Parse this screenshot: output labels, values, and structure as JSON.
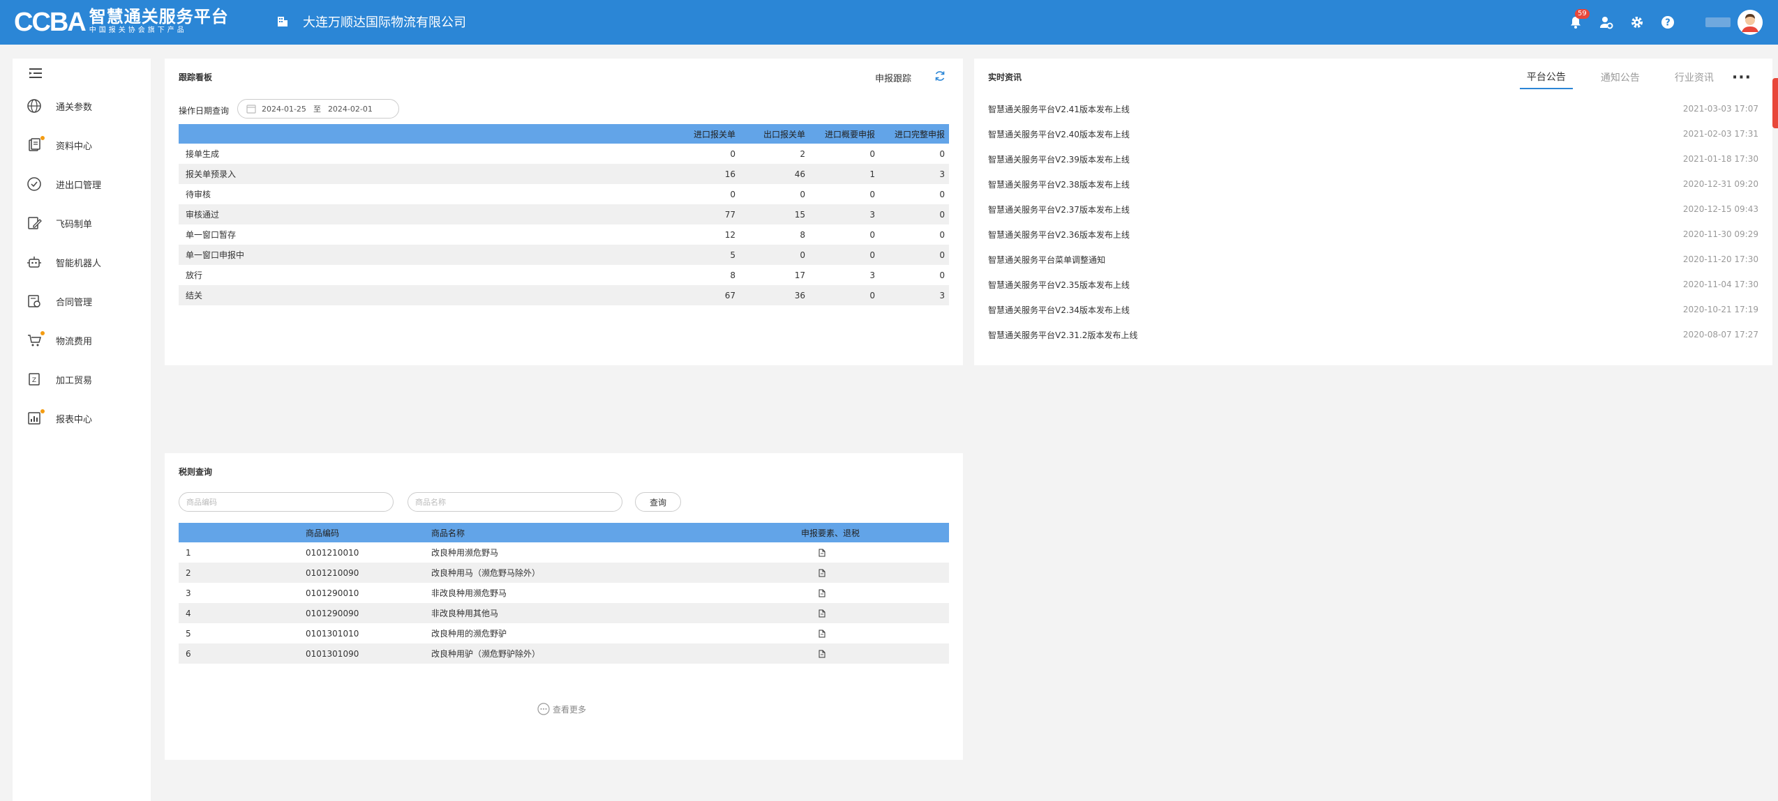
{
  "header": {
    "logo_mark": "CCBA",
    "logo_cn": "智慧通关服务平台",
    "logo_sub": "中国报关协会旗下产品",
    "company": "大连万顺达国际物流有限公司",
    "notification_count": "59"
  },
  "sidebar": {
    "items": [
      {
        "label": "通关参数",
        "icon": "globe-icon",
        "dot": false
      },
      {
        "label": "资料中心",
        "icon": "documents-icon",
        "dot": true
      },
      {
        "label": "进出口管理",
        "icon": "clock-check-icon",
        "dot": false
      },
      {
        "label": "飞码制单",
        "icon": "edit-doc-icon",
        "dot": false
      },
      {
        "label": "智能机器人",
        "icon": "robot-icon",
        "dot": false
      },
      {
        "label": "合同管理",
        "icon": "contract-icon",
        "dot": false
      },
      {
        "label": "物流费用",
        "icon": "cart-icon",
        "dot": true
      },
      {
        "label": "加工贸易",
        "icon": "trade-icon",
        "dot": false
      },
      {
        "label": "报表中心",
        "icon": "chart-icon",
        "dot": true
      }
    ]
  },
  "tracking": {
    "title": "跟踪看板",
    "link": "申报跟踪",
    "date_label": "操作日期查询",
    "date_from": "2024-01-25",
    "date_sep": "至",
    "date_to": "2024-02-01",
    "columns": [
      "",
      "进口报关单",
      "出口报关单",
      "进口概要申报",
      "进口完整申报"
    ],
    "rows": [
      [
        "接单生成",
        "0",
        "2",
        "0",
        "0"
      ],
      [
        "报关单预录入",
        "16",
        "46",
        "1",
        "3"
      ],
      [
        "待审核",
        "0",
        "0",
        "0",
        "0"
      ],
      [
        "审核通过",
        "77",
        "15",
        "3",
        "0"
      ],
      [
        "单一窗口暂存",
        "12",
        "8",
        "0",
        "0"
      ],
      [
        "单一窗口申报中",
        "5",
        "0",
        "0",
        "0"
      ],
      [
        "放行",
        "8",
        "17",
        "3",
        "0"
      ],
      [
        "结关",
        "67",
        "36",
        "0",
        "3"
      ]
    ]
  },
  "news": {
    "title": "实时资讯",
    "tabs": [
      "平台公告",
      "通知公告",
      "行业资讯"
    ],
    "more": "···",
    "items": [
      {
        "title": "智慧通关服务平台V2.41版本发布上线",
        "date": "2021-03-03 17:07"
      },
      {
        "title": "智慧通关服务平台V2.40版本发布上线",
        "date": "2021-02-03 17:31"
      },
      {
        "title": "智慧通关服务平台V2.39版本发布上线",
        "date": "2021-01-18 17:30"
      },
      {
        "title": "智慧通关服务平台V2.38版本发布上线",
        "date": "2020-12-31 09:20"
      },
      {
        "title": "智慧通关服务平台V2.37版本发布上线",
        "date": "2020-12-15 09:43"
      },
      {
        "title": "智慧通关服务平台V2.36版本发布上线",
        "date": "2020-11-30 09:29"
      },
      {
        "title": "智慧通关服务平台菜单调整通知",
        "date": "2020-11-20 17:30"
      },
      {
        "title": "智慧通关服务平台V2.35版本发布上线",
        "date": "2020-11-04 17:30"
      },
      {
        "title": "智慧通关服务平台V2.34版本发布上线",
        "date": "2020-10-21 17:19"
      },
      {
        "title": "智慧通关服务平台V2.31.2版本发布上线",
        "date": "2020-08-07 17:27"
      }
    ]
  },
  "tariff": {
    "title": "税则查询",
    "code_placeholder": "商品编码",
    "name_placeholder": "商品名称",
    "query_label": "查询",
    "columns": [
      "",
      "商品编码",
      "商品名称",
      "申报要素、退税"
    ],
    "rows": [
      [
        "1",
        "0101210010",
        "改良种用濒危野马"
      ],
      [
        "2",
        "0101210090",
        "改良种用马（濒危野马除外）"
      ],
      [
        "3",
        "0101290010",
        "非改良种用濒危野马"
      ],
      [
        "4",
        "0101290090",
        "非改良种用其他马"
      ],
      [
        "5",
        "0101301010",
        "改良种用的濒危野驴"
      ],
      [
        "6",
        "0101301090",
        "改良种用驴（濒危野驴除外）"
      ]
    ],
    "view_more": "查看更多"
  }
}
